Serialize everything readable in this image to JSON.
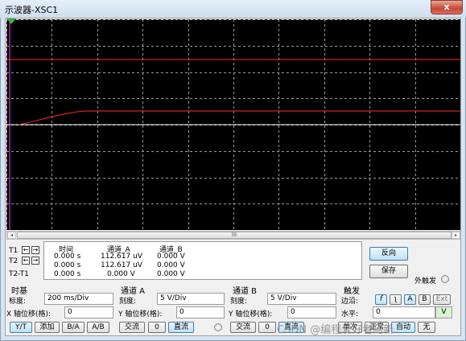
{
  "window": {
    "title": "示波器-XSC1",
    "close_label": "x"
  },
  "scrollbar": {
    "left": "◂",
    "right": "▸",
    "thumb_grip": "III"
  },
  "readout": {
    "headers": {
      "time": "时间",
      "ch_a": "通道_A",
      "ch_b": "通道_B"
    },
    "rows": [
      {
        "label": "T1",
        "time": "0.000 s",
        "a": "112.617 uV",
        "b": "0.000 V"
      },
      {
        "label": "T2",
        "time": "0.000 s",
        "a": "112.617 uV",
        "b": "0.000 V"
      },
      {
        "label": "T2-T1",
        "time": "0.000 s",
        "a": "0.000 V",
        "b": "0.000 V"
      }
    ],
    "arrow_left": "←",
    "arrow_right": "→"
  },
  "buttons": {
    "reverse": "反向",
    "save": "保存"
  },
  "ext_trigger": {
    "label": "外触发"
  },
  "timebase": {
    "title": "时基",
    "scale_label": "标度:",
    "scale_value": "200 ms/Div",
    "xpos_label": "X 轴位移(格):",
    "xpos_value": "0",
    "modes": [
      "Y/T",
      "添加",
      "B/A",
      "A/B"
    ],
    "active_mode": "Y/T"
  },
  "channel_a": {
    "title": "通道 A",
    "scale_label": "刻度:",
    "scale_value": "5  V/Div",
    "ypos_label": "Y 轴位移(格):",
    "ypos_value": "0",
    "coupling": [
      "交流",
      "0",
      "直流"
    ],
    "active_coupling": "直流"
  },
  "channel_b": {
    "title": "通道 B",
    "scale_label": "刻度:",
    "scale_value": "5  V/Div",
    "ypos_label": "Y 轴位移(格):",
    "ypos_value": "0",
    "coupling": [
      "交流",
      "0",
      "直流"
    ],
    "active_coupling": "直流"
  },
  "trigger": {
    "title": "触发",
    "edge_label": "边沿:",
    "edge_buttons": [
      "f",
      "ʅ",
      "A",
      "B",
      "Ext"
    ],
    "level_label": "水平:",
    "level_value": "0",
    "level_unit": "V",
    "modes_partial": [
      "单次",
      "正常",
      "自动",
      "无"
    ]
  },
  "watermark": "CSDN @编程爱好者阿新",
  "scope": {
    "trace_colors": {
      "channel_a": "#ff2a2a",
      "cursor_t1": "#ff40ff",
      "grid": "#9a9a9a",
      "axis": "#ffffff"
    }
  }
}
